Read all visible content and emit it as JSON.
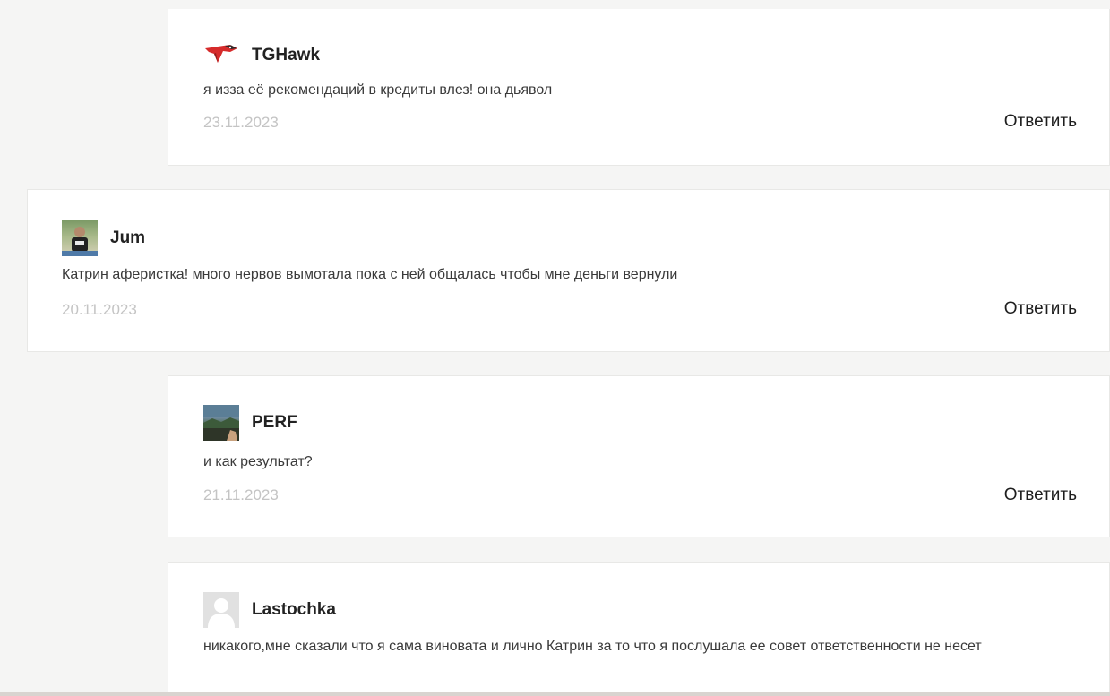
{
  "comments": [
    {
      "author": "TGHawk",
      "avatar_icon": "hawk-logo-icon",
      "text": "я изза её рекомендаций в кредиты влез! она дьявол",
      "date": "23.11.2023",
      "reply_label": "Ответить"
    },
    {
      "author": "Jum",
      "avatar_icon": "user-photo-icon",
      "text": "Катрин аферистка! много нервов вымотала пока с ней общалась чтобы мне деньги вернули",
      "date": "20.11.2023",
      "reply_label": "Ответить"
    },
    {
      "author": "PERF",
      "avatar_icon": "landscape-photo-icon",
      "text": "и как результат?",
      "date": "21.11.2023",
      "reply_label": "Ответить"
    },
    {
      "author": "Lastochka",
      "avatar_icon": "default-user-icon",
      "text": "никакого,мне сказали что я сама виновата и лично Катрин за то что я послушала ее совет ответственности не несет"
    }
  ],
  "colors": {
    "background": "#f5f5f4",
    "card": "#ffffff",
    "date": "#c4c4c4",
    "hawk_red": "#d62b2b"
  }
}
